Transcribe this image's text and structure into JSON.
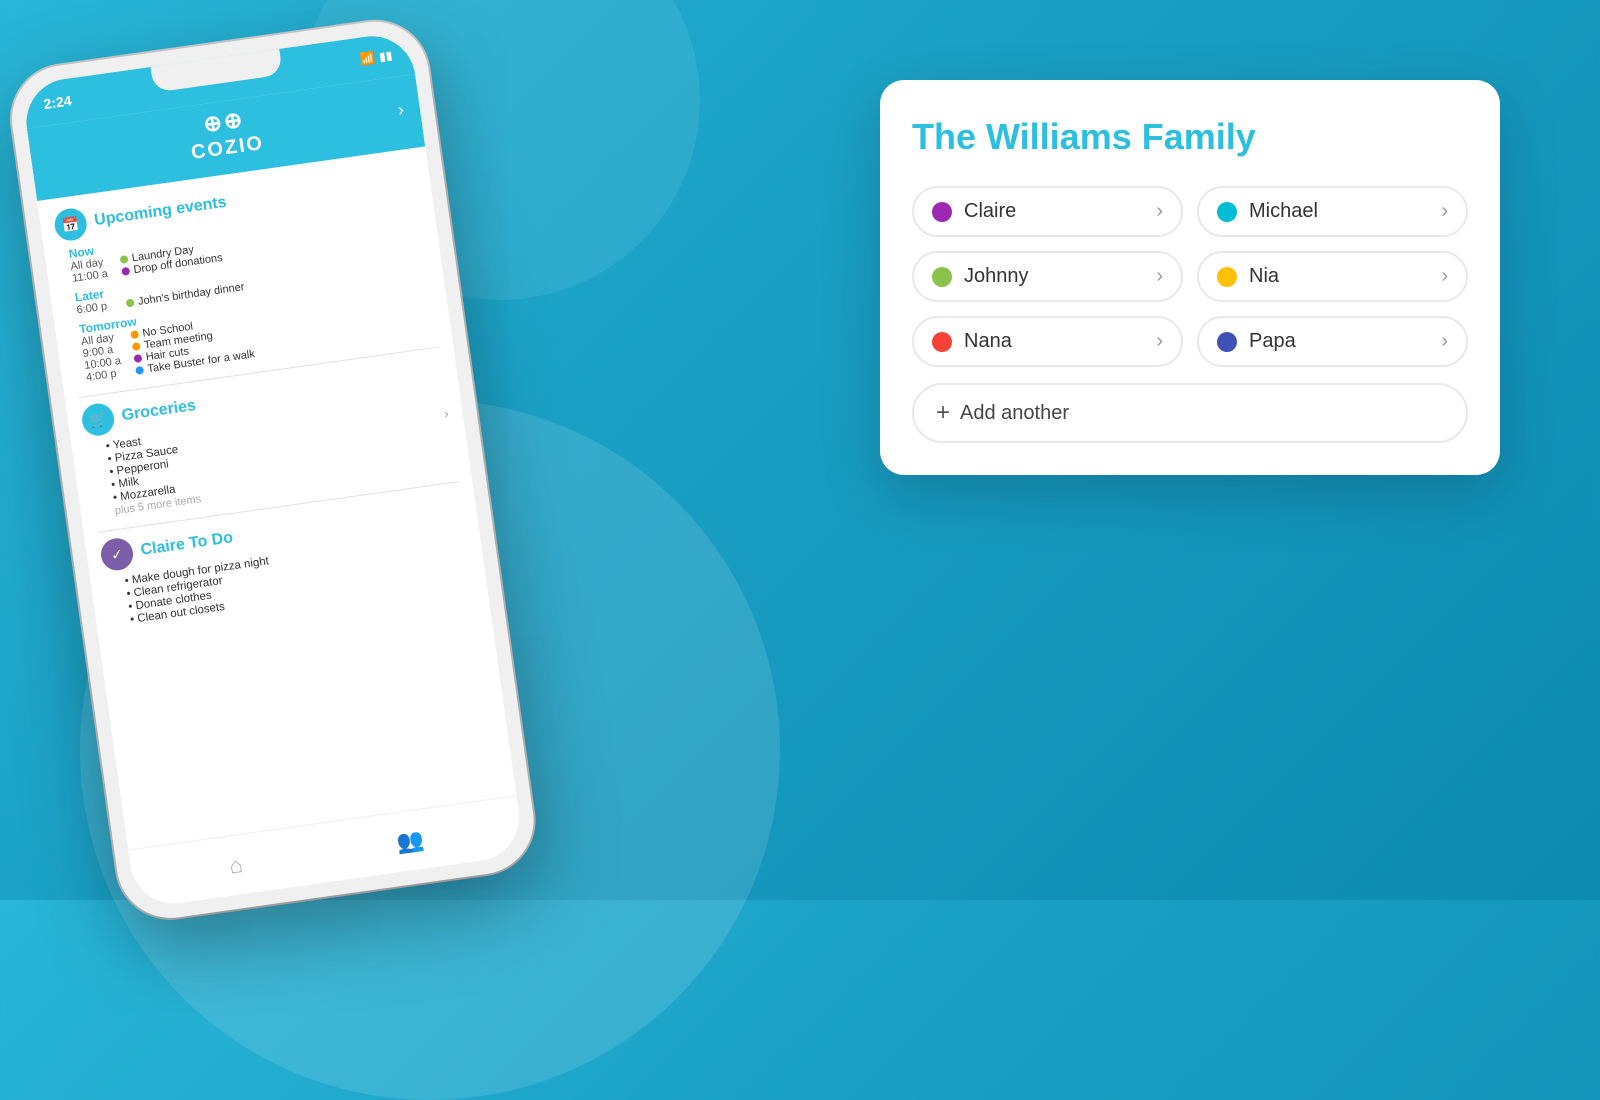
{
  "background": {
    "color": "#29b6d8"
  },
  "phone": {
    "status_time": "2:24",
    "header_logo": "COZIO",
    "sections": {
      "events": {
        "title": "Upcoming events",
        "now": {
          "label": "Now",
          "items": [
            {
              "time": "All day",
              "text": "Laundry Day",
              "color": "#8BC34A"
            },
            {
              "time": "11:00 a",
              "text": "Drop off donations",
              "color": "#9C27B0"
            }
          ]
        },
        "later": {
          "label": "Later",
          "items": [
            {
              "time": "6:00 p",
              "text": "John's birthday dinner",
              "color": "#8BC34A"
            }
          ]
        },
        "tomorrow": {
          "label": "Tomorrow",
          "items": [
            {
              "time": "All day",
              "text": "No School",
              "color": "#FF9800"
            },
            {
              "time": "9:00 a",
              "text": "Team meeting",
              "color": "#FF9800"
            },
            {
              "time": "10:00 a",
              "text": "Hair cuts",
              "color": "#9C27B0"
            },
            {
              "time": "4:00 p",
              "text": "Take Buster for a walk",
              "color": "#2196F3"
            }
          ]
        }
      },
      "groceries": {
        "title": "Groceries",
        "items": [
          "Yeast",
          "Pizza Sauce",
          "Pepperoni",
          "Milk",
          "Mozzarella"
        ],
        "more_text": "plus 5 more items"
      },
      "todo": {
        "title": "Claire To Do",
        "items": [
          "Make dough for pizza night",
          "Clean refrigerator",
          "Donate clothes",
          "Clean out closets"
        ]
      }
    }
  },
  "family_card": {
    "title": "The Williams Family",
    "members": [
      {
        "name": "Claire",
        "color": "#9C27B0",
        "col": 0
      },
      {
        "name": "Michael",
        "color": "#00BCD4",
        "col": 1
      },
      {
        "name": "Johnny",
        "color": "#8BC34A",
        "col": 0
      },
      {
        "name": "Nia",
        "color": "#FFC107",
        "col": 1
      },
      {
        "name": "Nana",
        "color": "#F44336",
        "col": 0
      },
      {
        "name": "Papa",
        "color": "#3F51B5",
        "col": 1
      }
    ],
    "add_another_label": "Add another"
  }
}
